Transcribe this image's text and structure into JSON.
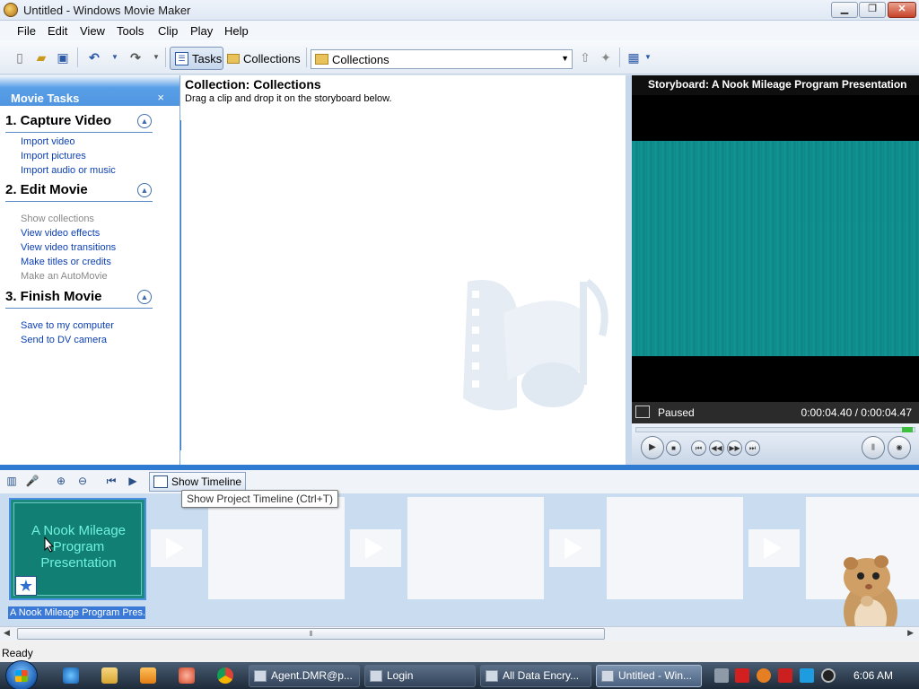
{
  "window": {
    "title": "Untitled - Windows Movie Maker"
  },
  "menu": [
    "File",
    "Edit",
    "View",
    "Tools",
    "Clip",
    "Play",
    "Help"
  ],
  "toolbar": {
    "tasks_label": "Tasks",
    "collections_label": "Collections",
    "collection_select_value": "Collections"
  },
  "tasks": {
    "header": "Movie Tasks",
    "close_glyph": "×",
    "sections": [
      {
        "title": "1. Capture Video",
        "items": [
          {
            "label": "Import video",
            "enabled": true
          },
          {
            "label": "Import pictures",
            "enabled": true
          },
          {
            "label": "Import audio or music",
            "enabled": true
          }
        ]
      },
      {
        "title": "2. Edit Movie",
        "items": [
          {
            "label": "Show collections",
            "enabled": false
          },
          {
            "label": "View video effects",
            "enabled": true
          },
          {
            "label": "View video transitions",
            "enabled": true
          },
          {
            "label": "Make titles or credits",
            "enabled": true
          },
          {
            "label": "Make an AutoMovie",
            "enabled": false
          }
        ]
      },
      {
        "title": "3. Finish Movie",
        "items": [
          {
            "label": "Save to my computer",
            "enabled": true
          },
          {
            "label": "Send to DV camera",
            "enabled": true
          }
        ]
      }
    ]
  },
  "collection": {
    "title": "Collection: Collections",
    "hint": "Drag a clip and drop it on the storyboard below."
  },
  "preview": {
    "title": "Storyboard: A Nook Mileage Program Presentation",
    "status": "Paused",
    "time": "0:00:04.40 / 0:00:04.47"
  },
  "storyboard": {
    "show_timeline_label": "Show Timeline",
    "tooltip": "Show Project Timeline (Ctrl+T)",
    "clip_text": "A Nook Mileage Program Presentation",
    "clip_label": "A Nook Mileage Program Pres..."
  },
  "status_bar": {
    "text": "Ready"
  },
  "taskbar": {
    "tasks": [
      {
        "label": "Agent.DMR@p...",
        "active": false
      },
      {
        "label": "Login",
        "active": false
      },
      {
        "label": "All Data Encry...",
        "active": false
      },
      {
        "label": "Untitled - Win...",
        "active": true
      }
    ],
    "clock": "6:06 AM"
  },
  "colors": {
    "accent": "#2f7bd1",
    "task_link": "#0c3fb5",
    "clip_bg": "#127f74",
    "clip_text": "#6ff3df"
  }
}
